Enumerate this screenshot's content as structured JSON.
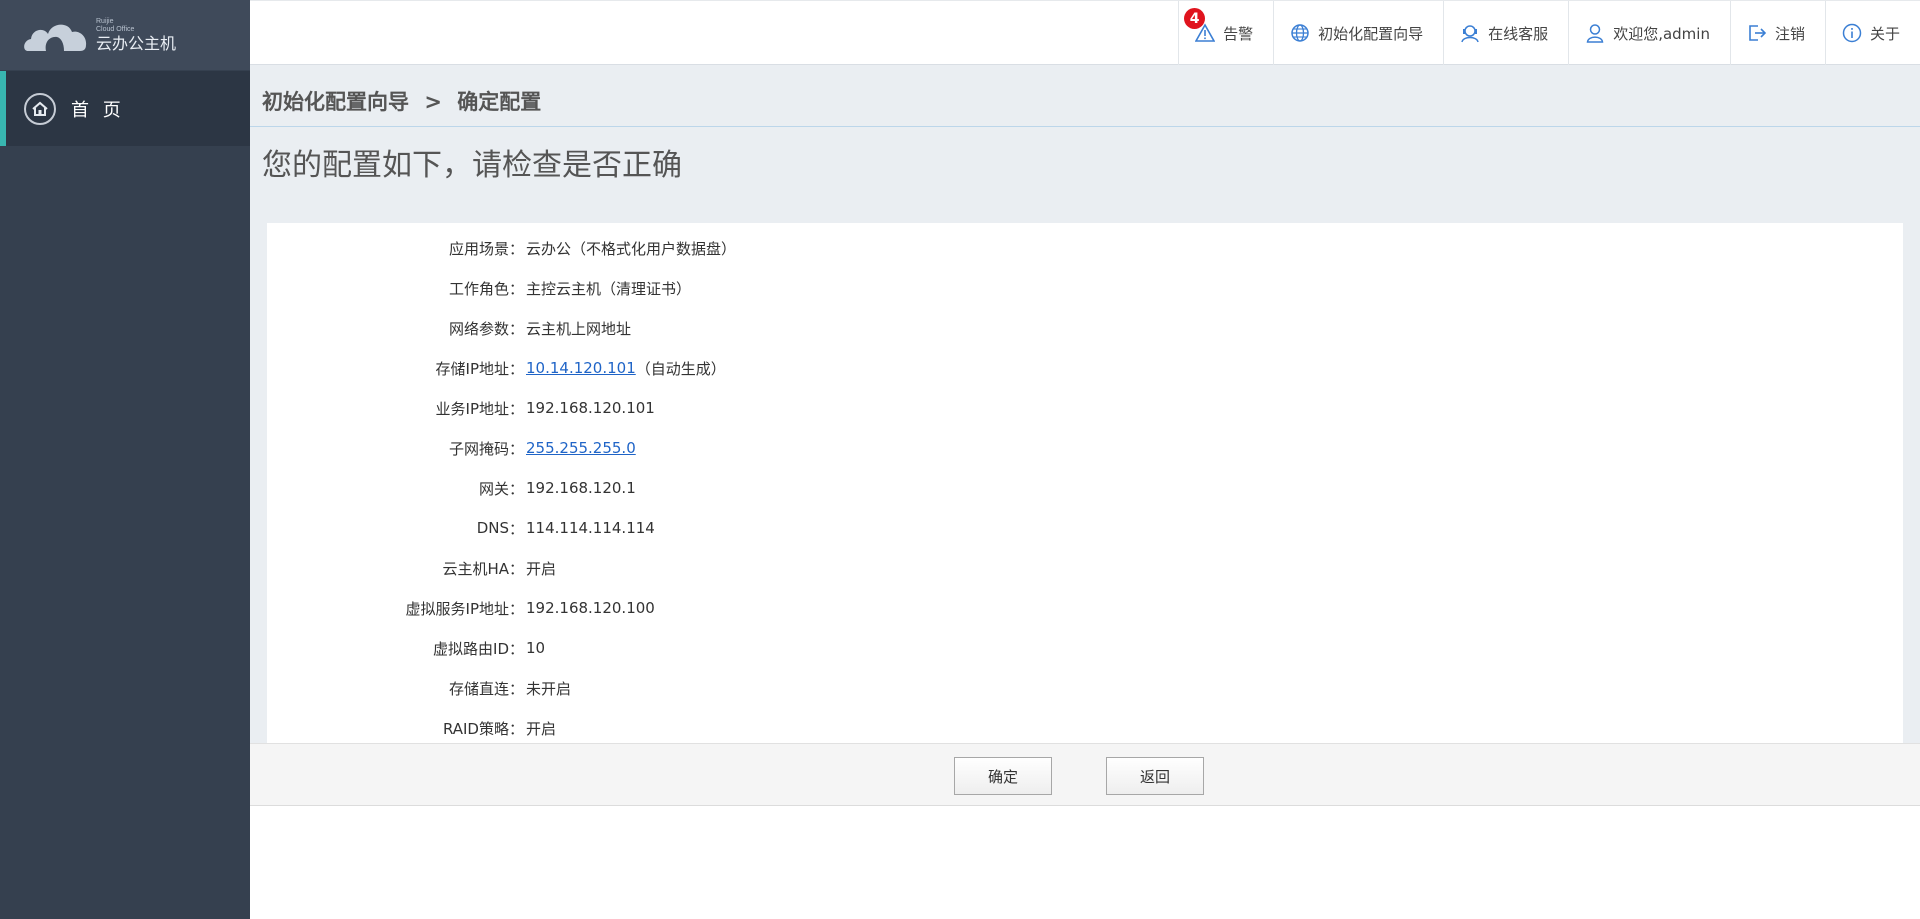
{
  "app": {
    "logo_small": "Ruijie\nCloud Office",
    "logo_main": "云办公主机"
  },
  "sidebar": {
    "items": [
      {
        "label": "首 页",
        "icon": "home-icon"
      }
    ]
  },
  "topbar": {
    "items": [
      {
        "label": "告警",
        "icon": "warning-icon",
        "badge": "4"
      },
      {
        "label": "初始化配置向导",
        "icon": "globe-icon"
      },
      {
        "label": "在线客服",
        "icon": "support-agent-icon"
      },
      {
        "label": "欢迎您,admin",
        "icon": "user-icon"
      },
      {
        "label": "注销",
        "icon": "logout-icon"
      },
      {
        "label": "关于",
        "icon": "info-icon"
      }
    ]
  },
  "breadcrumb": {
    "parent": "初始化配置向导",
    "separator": ">",
    "current": "确定配置"
  },
  "page_title": "您的配置如下，请检查是否正确",
  "config": [
    {
      "label": "应用场景",
      "value": "云办公（不格式化用户数据盘）"
    },
    {
      "label": "工作角色",
      "value": "主控云主机（清理证书）"
    },
    {
      "label": "网络参数",
      "value": "云主机上网地址"
    },
    {
      "label": "存储IP地址",
      "link": "10.14.120.101",
      "value": "（自动生成）"
    },
    {
      "label": "业务IP地址",
      "value": "192.168.120.101"
    },
    {
      "label": "子网掩码",
      "link": "255.255.255.0"
    },
    {
      "label": "网关",
      "value": "192.168.120.1"
    },
    {
      "label": "DNS",
      "value": "114.114.114.114"
    },
    {
      "label": "云主机HA",
      "value": "开启"
    },
    {
      "label": "虚拟服务IP地址",
      "value": "192.168.120.100"
    },
    {
      "label": "虚拟路由ID",
      "value": "10"
    },
    {
      "label": "存储直连",
      "value": "未开启"
    },
    {
      "label": "RAID策略",
      "value": "开启"
    }
  ],
  "colon": "：",
  "buttons": {
    "confirm": "确定",
    "back": "返回"
  },
  "colors": {
    "sidebar_bg": "#35404f",
    "accent": "#38b6b0",
    "link": "#1f64c7",
    "badge": "#e0141e"
  }
}
